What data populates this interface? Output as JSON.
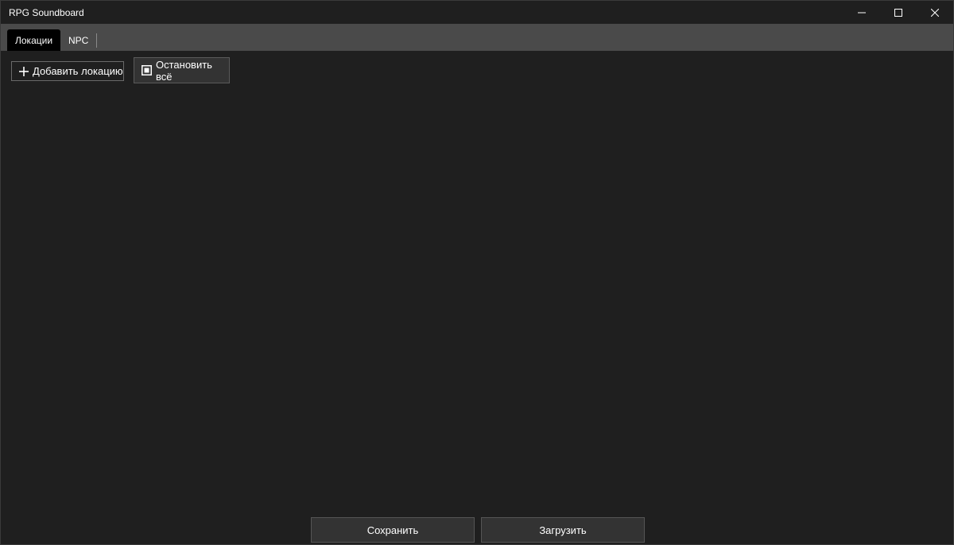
{
  "window": {
    "title": "RPG Soundboard",
    "controls": {
      "minimize_icon": "minimize-icon",
      "maximize_icon": "maximize-icon",
      "close_icon": "close-icon"
    }
  },
  "tabs": [
    {
      "label": "Локации",
      "active": true
    },
    {
      "label": "NPC",
      "active": false
    }
  ],
  "toolbar": {
    "add_location": {
      "label": "Добавить локацию",
      "icon": "plus-icon"
    },
    "stop_all": {
      "label": "Остановить всё",
      "icon": "stop-icon"
    }
  },
  "footer": {
    "save_label": "Сохранить",
    "load_label": "Загрузить"
  },
  "colors": {
    "background": "#1f1f1f",
    "tabstrip": "#4a4a4a",
    "active_tab": "#000000",
    "button_fill": "#333333",
    "text": "#ffffff"
  }
}
